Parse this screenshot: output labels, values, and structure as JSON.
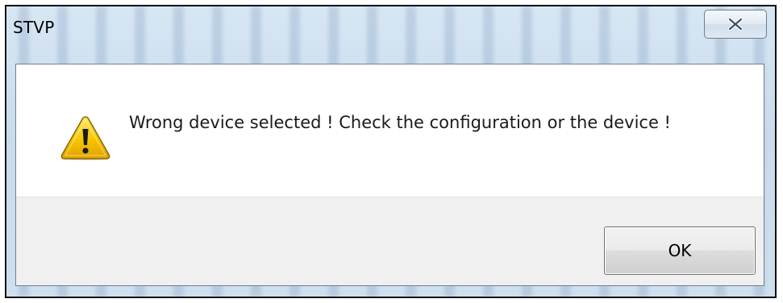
{
  "window": {
    "title": "STVP",
    "close_icon": "close-icon"
  },
  "dialog": {
    "icon": "warning-icon",
    "message": "Wrong device selected ! Check the configuration or the device !",
    "ok_label": "OK"
  },
  "colors": {
    "warning_fill": "#f5c400",
    "warning_border": "#8a6a00",
    "title_glass": "#c9dced"
  }
}
